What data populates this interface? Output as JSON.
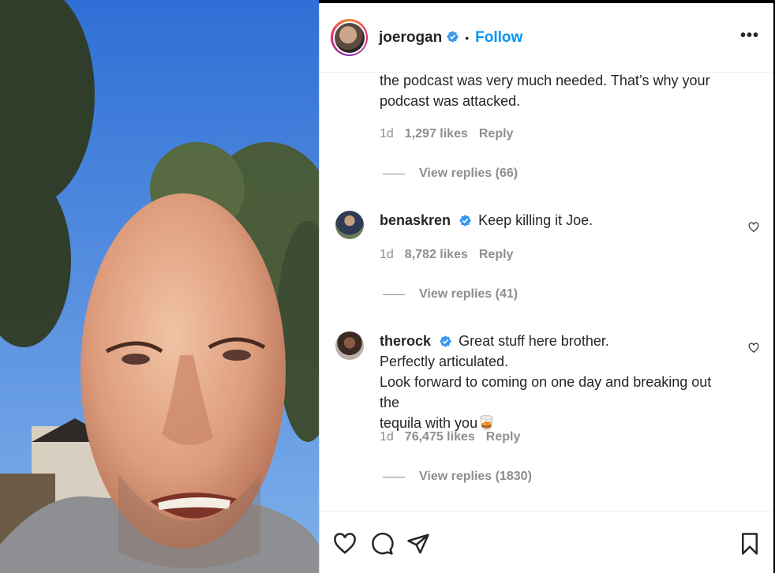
{
  "post": {
    "username": "joerogan",
    "separator": "•",
    "follow_label": "Follow",
    "more_label": "•••"
  },
  "comments": [
    {
      "username": "",
      "text_lines": [
        "the podcast was very much needed. That’s why your",
        "podcast was attacked."
      ],
      "age": "1d",
      "likes": "1,297 likes",
      "reply_label": "Reply",
      "view_replies": "View replies (66)"
    },
    {
      "username": "benaskren",
      "text_lines": [
        "Keep killing it Joe."
      ],
      "age": "1d",
      "likes": "8,782 likes",
      "reply_label": "Reply",
      "view_replies": "View replies (41)"
    },
    {
      "username": "therock",
      "text_lines": [
        "Great stuff here brother.",
        "Perfectly articulated.",
        "Look forward to coming on one day and breaking out the",
        "tequila with you🥃"
      ],
      "age": "1d",
      "likes": "76,475 likes",
      "reply_label": "Reply",
      "view_replies": "View replies (1830)"
    }
  ],
  "icons": {
    "verified": "verified-badge-icon",
    "like": "heart-icon",
    "comment": "comment-bubble-icon",
    "share": "paper-plane-icon",
    "save": "bookmark-icon"
  },
  "colors": {
    "accent": "#0095f6",
    "text": "#262626",
    "muted": "#8e8e8e"
  }
}
